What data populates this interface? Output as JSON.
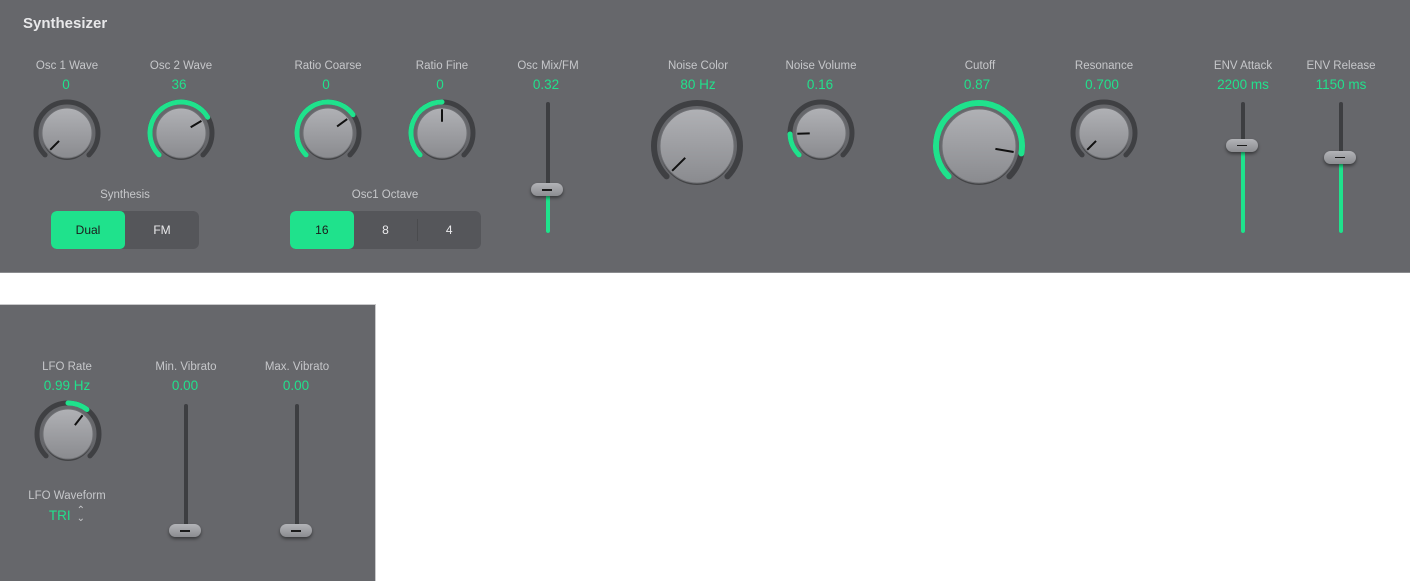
{
  "title": "Synthesizer",
  "colors": {
    "accent": "#1fe28c",
    "panel": "#66676b",
    "ring": "#3f4043",
    "label": "#c6c7ca"
  },
  "knobs": [
    {
      "id": "osc1-wave",
      "label": "Osc 1 Wave",
      "value": "0",
      "fraction": 0.0
    },
    {
      "id": "osc2-wave",
      "label": "Osc 2 Wave",
      "value": "36",
      "fraction": 0.72
    },
    {
      "id": "ratio-coarse",
      "label": "Ratio Coarse",
      "value": "0",
      "fraction": 0.7
    },
    {
      "id": "ratio-fine",
      "label": "Ratio Fine",
      "value": "0",
      "fraction": 0.5
    },
    {
      "id": "noise-color",
      "label": "Noise Color",
      "value": "80 Hz",
      "fraction": 0.0
    },
    {
      "id": "noise-volume",
      "label": "Noise Volume",
      "value": "0.16",
      "fraction": 0.16
    },
    {
      "id": "cutoff",
      "label": "Cutoff",
      "value": "0.87",
      "fraction": 0.87
    },
    {
      "id": "resonance",
      "label": "Resonance",
      "value": "0.700",
      "fraction": 0.0
    },
    {
      "id": "lfo-rate",
      "label": "LFO Rate",
      "value": "0.99 Hz",
      "fraction": 0.64,
      "arc_from": 0.5
    }
  ],
  "synthesis": {
    "label": "Synthesis",
    "options": [
      "Dual",
      "FM"
    ],
    "selected": "Dual"
  },
  "octave": {
    "label": "Osc1 Octave",
    "options": [
      "16",
      "8",
      "4"
    ],
    "selected": "16"
  },
  "sliders": [
    {
      "id": "osc-mix",
      "label": "Osc Mix/FM",
      "value": "0.32",
      "fraction": 0.32
    },
    {
      "id": "env-attack",
      "label": "ENV Attack",
      "value": "2200 ms",
      "fraction": 0.69
    },
    {
      "id": "env-release",
      "label": "ENV Release",
      "value": "1150 ms",
      "fraction": 0.59
    },
    {
      "id": "min-vibrato",
      "label": "Min. Vibrato",
      "value": "0.00",
      "fraction": 0.0
    },
    {
      "id": "max-vibrato",
      "label": "Max. Vibrato",
      "value": "0.00",
      "fraction": 0.0
    }
  ],
  "lfo_waveform": {
    "label": "LFO Waveform",
    "value": "TRI",
    "icon": "up-down-chevron-icon"
  }
}
